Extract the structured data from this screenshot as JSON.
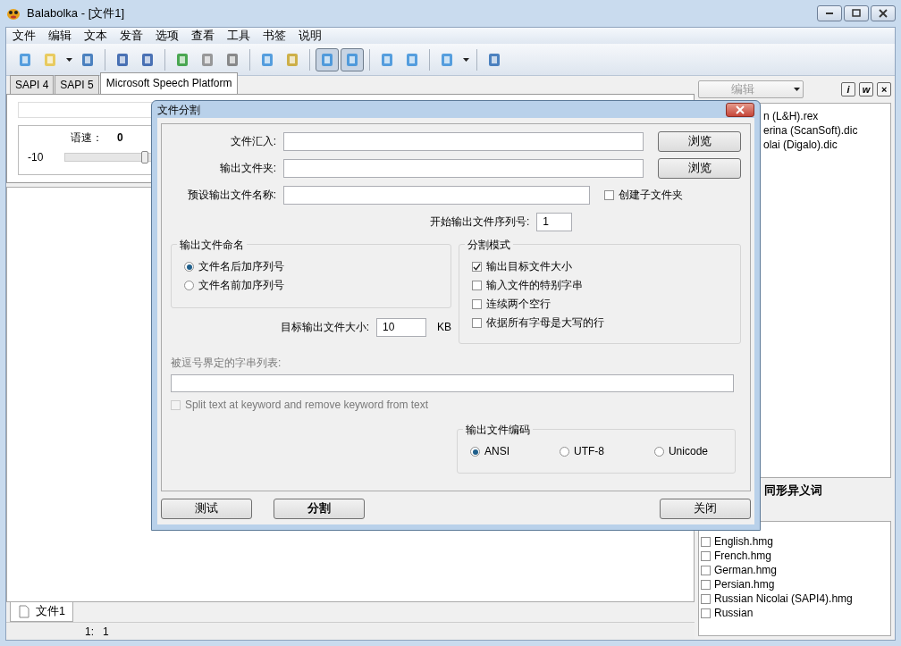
{
  "window": {
    "title": "Balabolka - [文件1]"
  },
  "menu": [
    "文件",
    "编辑",
    "文本",
    "发音",
    "选项",
    "查看",
    "工具",
    "书签",
    "说明"
  ],
  "toolbar": [
    [
      {
        "pressed": false
      },
      {
        "pressed": false,
        "dropdown": true
      },
      {
        "pressed": false
      }
    ],
    [
      {
        "pressed": false
      },
      {
        "pressed": false
      }
    ],
    [
      {
        "pressed": false
      },
      {
        "pressed": false
      },
      {
        "pressed": false
      }
    ],
    [
      {
        "pressed": false
      },
      {
        "pressed": false
      }
    ],
    [
      {
        "pressed": true
      },
      {
        "pressed": true
      }
    ],
    [
      {
        "pressed": false
      },
      {
        "pressed": false
      }
    ],
    [
      {
        "pressed": false,
        "dropdown": true
      }
    ],
    [
      {
        "pressed": false
      }
    ]
  ],
  "engine_tabs": [
    {
      "label": "SAPI 4",
      "selected": false
    },
    {
      "label": "SAPI 5",
      "selected": false
    },
    {
      "label": "Microsoft Speech Platform",
      "selected": true
    }
  ],
  "rate": {
    "label": "语速：",
    "value": "0",
    "min_label": "-10",
    "level": 0.5
  },
  "right_panel": {
    "dropdown": "编辑",
    "buttons": [
      "i",
      "w",
      "×"
    ],
    "files": [
      "n (L&H).rex",
      "erina (ScanSoft).dic",
      "olai (Digalo).dic"
    ],
    "homograph_title": "同形异义词",
    "homograph_files": [
      {
        "label": "English.hmg",
        "checked": false
      },
      {
        "label": "French.hmg",
        "checked": false
      },
      {
        "label": "German.hmg",
        "checked": false
      },
      {
        "label": "Persian.hmg",
        "checked": false
      },
      {
        "label": "Russian Nicolai (SAPI4).hmg",
        "checked": false
      },
      {
        "label": "Russian",
        "checked": false
      }
    ]
  },
  "doc_tabs": [
    {
      "label": "文件1",
      "selected": true
    }
  ],
  "status_bar": {
    "position": "1:   1"
  },
  "dialog": {
    "title": "文件分割",
    "fields": [
      {
        "label": "文件汇入:",
        "button": "浏览"
      },
      {
        "label": "输出文件夹:",
        "button": "浏览"
      }
    ],
    "name_field": {
      "label": "预设输出文件名称:"
    },
    "create_subfolder": {
      "label": "创建子文件夹",
      "checked": false
    },
    "start_number": {
      "label": "开始输出文件序列号:",
      "value": "1"
    },
    "naming": {
      "title": "输出文件命名",
      "options": [
        {
          "label": "文件名后加序列号",
          "selected": true
        },
        {
          "label": "文件名前加序列号",
          "selected": false
        }
      ]
    },
    "split_mode": {
      "title": "分割模式",
      "options": [
        {
          "label": "输出目标文件大小",
          "checked": true
        },
        {
          "label": "输入文件的特别字串",
          "checked": false
        },
        {
          "label": "连续两个空行",
          "checked": false
        },
        {
          "label": "依据所有字母是大写的行",
          "checked": false
        }
      ]
    },
    "target_size": {
      "label": "目标输出文件大小:",
      "value": "10",
      "unit": "KB"
    },
    "string_list": {
      "label": "被逗号界定的字串列表:",
      "disabled": true
    },
    "keyword_split": {
      "label": "Split text at keyword and remove keyword from text",
      "checked": false,
      "disabled": true
    },
    "encoding": {
      "title": "输出文件编码",
      "options": [
        {
          "label": "ANSI",
          "selected": true
        },
        {
          "label": "UTF-8",
          "selected": false
        },
        {
          "label": "Unicode",
          "selected": false
        }
      ]
    },
    "buttons": [
      {
        "label": "测试",
        "bold": false
      },
      {
        "label": "分割",
        "bold": true
      },
      {
        "label": "关闭",
        "bold": false
      }
    ]
  }
}
